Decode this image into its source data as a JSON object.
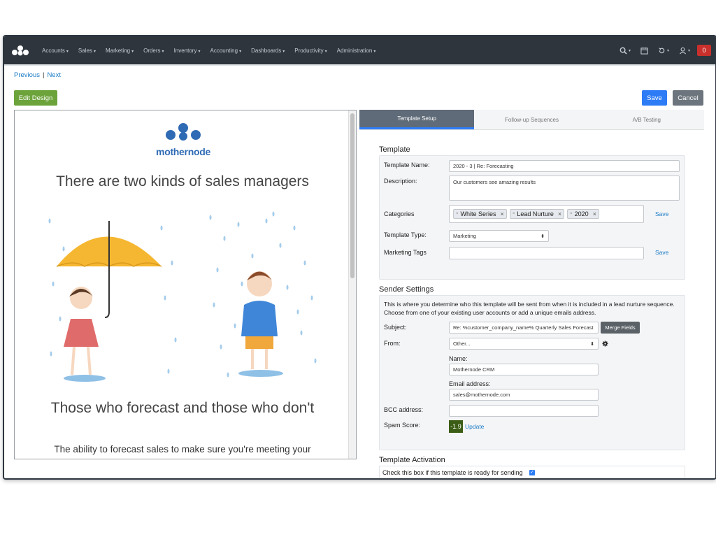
{
  "nav": {
    "menu": [
      "Accounts",
      "Sales",
      "Marketing",
      "Orders",
      "Inventory",
      "Accounting",
      "Dashboards",
      "Productivity",
      "Administration"
    ],
    "notifications": "0"
  },
  "pager": {
    "previous": "Previous",
    "separator": "|",
    "next": "Next"
  },
  "toolbar": {
    "edit_design": "Edit Design",
    "save": "Save",
    "cancel": "Cancel"
  },
  "preview": {
    "logo_text": "mothernode",
    "headline": "There are two kinds of sales managers",
    "subheadline": "Those who forecast and those who don't",
    "body": "The ability to forecast sales to make sure you're meeting your"
  },
  "tabs": [
    "Template Setup",
    "Follow-up Sequences",
    "A/B Testing"
  ],
  "template": {
    "section_title": "Template",
    "name_label": "Template Name:",
    "name_value": "2020 - 3 | Re: Forecasting",
    "description_label": "Description:",
    "description_value": "Our customers see amazing results",
    "categories_label": "Categories",
    "categories": [
      "White Series",
      "Lead Nurture",
      "2020"
    ],
    "categories_save": "Save",
    "type_label": "Template Type:",
    "type_value": "Marketing",
    "tags_label": "Marketing Tags",
    "tags_value": "",
    "tags_save": "Save"
  },
  "sender": {
    "section_title": "Sender Settings",
    "description": "This is where you determine who this template will be sent from when it is included in a lead nurture sequence. Choose from one of your existing user accounts or add a unique emails address.",
    "subject_label": "Subject:",
    "subject_value": "Re: %customer_company_name% Quarterly Sales Forecast",
    "merge_fields": "Merge Fields",
    "from_label": "From:",
    "from_value": "Other...",
    "name_label": "Name:",
    "name_value": "Mothernode CRM",
    "email_label": "Email address:",
    "email_value": "sales@mothernode.com",
    "bcc_label": "BCC address:",
    "bcc_value": "",
    "spam_label": "Spam Score:",
    "spam_value": "-1.9",
    "spam_update": "Update"
  },
  "activation": {
    "section_title": "Template Activation",
    "checkbox_label": "Check this box if this template is ready for sending",
    "checked": true
  },
  "colors": {
    "navbar": "#2e353d",
    "primary": "#2d7cf6",
    "edit": "#6da33b",
    "spam": "#3b5d15",
    "logo": "#2f6bb4"
  }
}
